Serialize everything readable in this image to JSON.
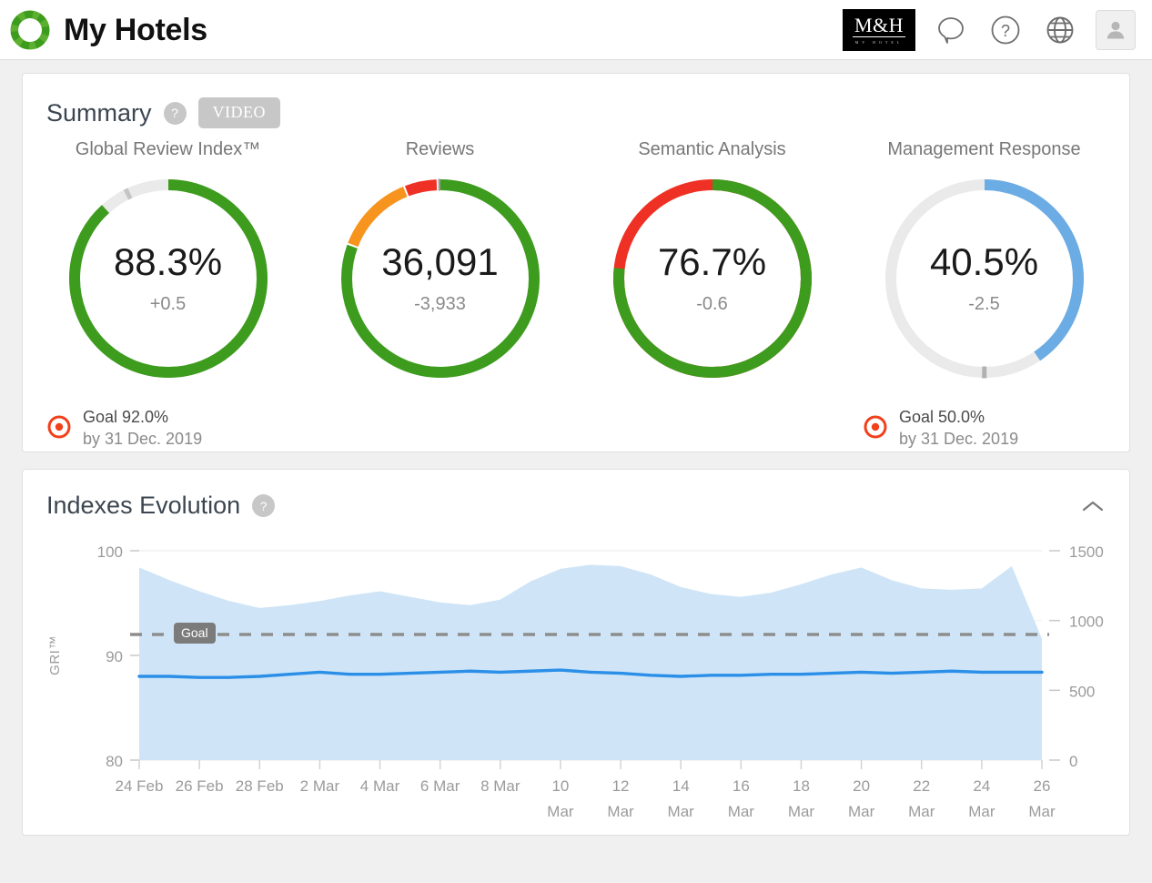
{
  "topbar": {
    "title": "My Hotels",
    "logo_icon": "ring-logo-icon",
    "hotel_logo": {
      "main": "M&H",
      "amp": "&",
      "sub": "MY HOTEL"
    },
    "icons": [
      {
        "name": "feedback-icon",
        "label": "Feedback"
      },
      {
        "name": "help-icon",
        "label": "Help"
      },
      {
        "name": "language-globe-icon",
        "label": "Language"
      },
      {
        "name": "user-avatar-icon",
        "label": "Account"
      }
    ]
  },
  "summary": {
    "title": "Summary",
    "help_label": "?",
    "video_label": "VIDEO",
    "kpis": [
      {
        "label": "Global Review Index™",
        "value": "88.3%",
        "delta": "+0.5",
        "percent": 88.3,
        "color": "#3d9c1e",
        "track_color": "#eaeaea",
        "marker_percent": 92.0,
        "marker_color": "#c4c4c4",
        "goal": {
          "main": "Goal 92.0%",
          "sub": "by 31 Dec. 2019"
        }
      },
      {
        "label": "Reviews",
        "value": "36,091",
        "delta": "-3,933",
        "percent": 80.5,
        "color": "#3d9c1e",
        "segments": [
          {
            "color": "#3d9c1e",
            "percent": 80.5
          },
          {
            "color": "#f7941e",
            "percent": 13.0
          },
          {
            "color": "#ee3124",
            "percent": 5.5
          }
        ],
        "marker_percent": 99.3,
        "marker_color": "#9b9b9b",
        "goal": null
      },
      {
        "label": "Semantic Analysis",
        "value": "76.7%",
        "delta": "-0.6",
        "percent": 76.7,
        "color": "#3d9c1e",
        "track_color": "#ee3124",
        "goal": null
      },
      {
        "label": "Management Response",
        "value": "40.5%",
        "delta": "-2.5",
        "percent": 40.5,
        "color": "#6cace4",
        "track_color": "#eaeaea",
        "marker_percent": 50.0,
        "marker_color": "#b0b0b0",
        "goal": {
          "main": "Goal 50.0%",
          "sub": "by 31 Dec. 2019"
        }
      }
    ]
  },
  "indexes": {
    "title": "Indexes Evolution",
    "help_label": "?",
    "collapse_icon": "chevron-up-icon",
    "goal_badge": "Goal"
  },
  "chart_data": {
    "type": "line",
    "title": "Indexes Evolution",
    "ylabel": "GRI™",
    "ylim": [
      80,
      100
    ],
    "y_ticks": [
      80,
      90,
      100
    ],
    "y2lim": [
      0,
      1500
    ],
    "y2_ticks": [
      0,
      500,
      1000,
      1500
    ],
    "grid": true,
    "goal_line": 92.0,
    "goal_line_label": "Goal",
    "x_tick_labels": [
      "24 Feb",
      "26 Feb",
      "28 Feb",
      "2 Mar",
      "4 Mar",
      "6 Mar",
      "8 Mar",
      "10\nMar",
      "12\nMar",
      "14\nMar",
      "16\nMar",
      "18\nMar",
      "20\nMar",
      "22\nMar",
      "24\nMar",
      "26\nMar"
    ],
    "x": [
      "24 Feb",
      "25 Feb",
      "26 Feb",
      "27 Feb",
      "28 Feb",
      "1 Mar",
      "2 Mar",
      "3 Mar",
      "4 Mar",
      "5 Mar",
      "6 Mar",
      "7 Mar",
      "8 Mar",
      "9 Mar",
      "10 Mar",
      "11 Mar",
      "12 Mar",
      "13 Mar",
      "14 Mar",
      "15 Mar",
      "16 Mar",
      "17 Mar",
      "18 Mar",
      "19 Mar",
      "20 Mar",
      "21 Mar",
      "22 Mar",
      "23 Mar",
      "24 Mar",
      "25 Mar",
      "26 Mar"
    ],
    "series": [
      {
        "name": "GRI™",
        "type": "line",
        "axis": "left",
        "color": "#2b8fe8",
        "values": [
          88.0,
          88.0,
          87.9,
          87.9,
          88.0,
          88.2,
          88.4,
          88.2,
          88.2,
          88.3,
          88.4,
          88.5,
          88.4,
          88.5,
          88.6,
          88.4,
          88.3,
          88.1,
          88.0,
          88.1,
          88.1,
          88.2,
          88.2,
          88.3,
          88.4,
          88.3,
          88.4,
          88.5,
          88.4,
          88.4,
          88.4
        ]
      },
      {
        "name": "Reviews volume",
        "type": "area",
        "axis": "right",
        "color": "#cfe5f7",
        "values": [
          1380,
          1290,
          1210,
          1140,
          1090,
          1110,
          1140,
          1180,
          1210,
          1170,
          1130,
          1110,
          1150,
          1280,
          1370,
          1400,
          1390,
          1330,
          1240,
          1190,
          1170,
          1200,
          1260,
          1330,
          1380,
          1290,
          1230,
          1220,
          1230,
          1390,
          870
        ]
      }
    ]
  }
}
